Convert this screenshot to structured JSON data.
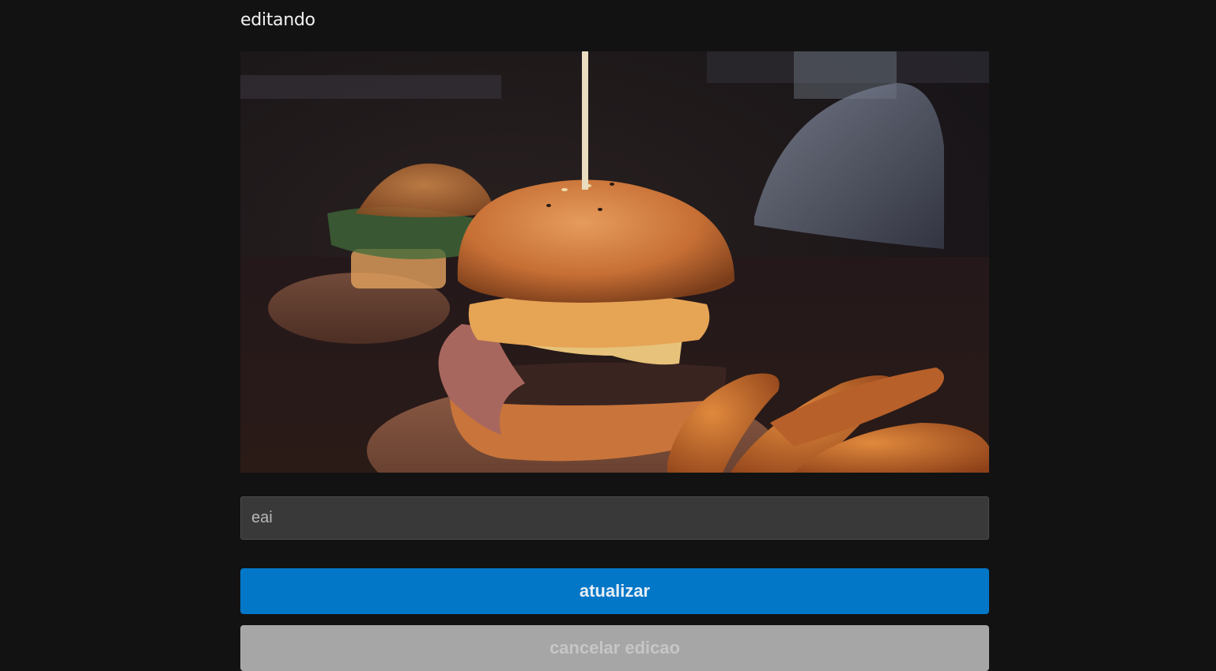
{
  "header": {
    "title": "editando"
  },
  "photo": {
    "alt": "burger photo"
  },
  "form": {
    "text_value": "eai",
    "submit_label": "atualizar",
    "cancel_label": "cancelar edicao"
  },
  "colors": {
    "background": "#121212",
    "primary": "#0277c8",
    "secondary": "#a6a6a6",
    "input_bg": "#393939"
  }
}
